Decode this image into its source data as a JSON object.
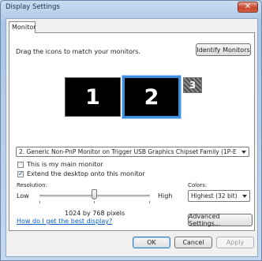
{
  "window": {
    "title": "Display Settings",
    "close_glyph": "✕"
  },
  "tabs": [
    {
      "label": "Monitor"
    }
  ],
  "instructions": "Drag the icons to match your monitors.",
  "identify_button": "Identify Monitors",
  "monitors": [
    {
      "number": "1",
      "selected": false,
      "active": true
    },
    {
      "number": "2",
      "selected": true,
      "active": true
    },
    {
      "number": "3",
      "selected": false,
      "active": false
    }
  ],
  "display_dropdown": {
    "value": "2. Generic Non-PnP Monitor on Trigger USB Graphics Chipset Family (1P-E"
  },
  "options": {
    "main_monitor": {
      "label": "This is my main monitor",
      "checked": false
    },
    "extend_desktop": {
      "label": "Extend the desktop onto this monitor",
      "checked": true
    }
  },
  "resolution": {
    "label": "Resolution:",
    "low": "Low",
    "high": "High",
    "value_text": "1024 by 768 pixels",
    "slider_fraction": 0.49
  },
  "colors": {
    "label": "Colors:",
    "value": "Highest (32 bit)"
  },
  "help_link": "How do I get the best display?",
  "advanced_button": "Advanced Settings...",
  "footer": {
    "ok": "OK",
    "cancel": "Cancel",
    "apply": "Apply"
  },
  "colors_theme": {
    "selected_border": "#3b8fe0",
    "monitor_fill": "#000000",
    "link": "#0a5cc2"
  }
}
